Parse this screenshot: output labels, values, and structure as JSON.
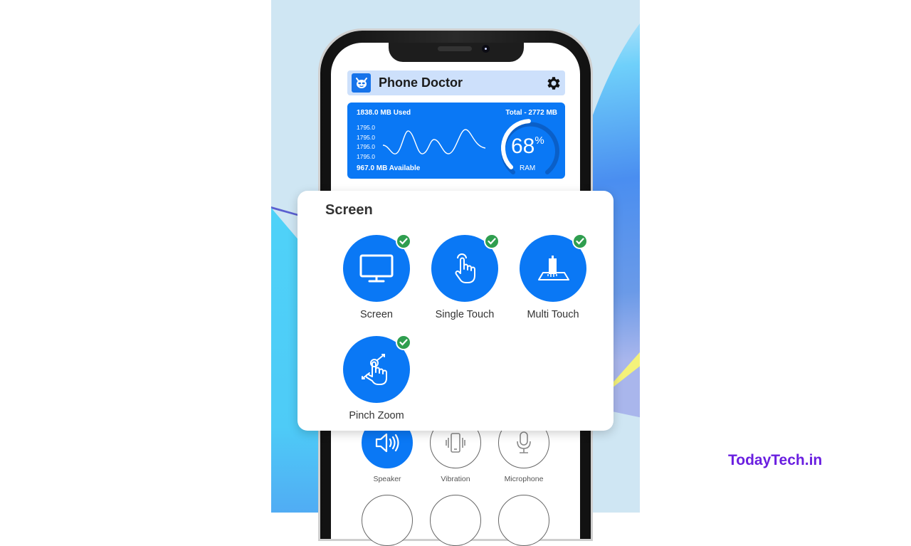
{
  "app": {
    "title": "Phone Doctor",
    "logo_icon": "robot-face-icon",
    "settings_icon": "gear-icon"
  },
  "ram": {
    "used": "1838.0 MB Used",
    "total": "Total - 2772 MB",
    "available": "967.0 MB Available",
    "ticks": [
      "1795.0",
      "1795.0",
      "1795.0",
      "1795.0"
    ],
    "percent_value": 68,
    "percent_text": "68",
    "percent_sign": "%",
    "label": "RAM"
  },
  "popup": {
    "title": "Screen",
    "tests": [
      {
        "label": "Screen",
        "icon": "monitor-icon",
        "status": "passed"
      },
      {
        "label": "Single Touch",
        "icon": "tap-finger-icon",
        "status": "passed"
      },
      {
        "label": "Multi Touch",
        "icon": "multi-touch-icon",
        "status": "passed"
      },
      {
        "label": "Pinch Zoom",
        "icon": "pinch-zoom-icon",
        "status": "passed"
      }
    ]
  },
  "bottom_tests": [
    {
      "label": "Speaker",
      "icon": "speaker-icon",
      "active": true
    },
    {
      "label": "Vibration",
      "icon": "vibration-icon",
      "active": false
    },
    {
      "label": "Microphone",
      "icon": "microphone-icon",
      "active": false
    }
  ],
  "watermark": "TodayTech.in",
  "colors": {
    "primary": "#0a78f5",
    "header_bg": "#cde0fb",
    "check_green": "#2f9e4f",
    "brand": "#6a1fe0"
  }
}
